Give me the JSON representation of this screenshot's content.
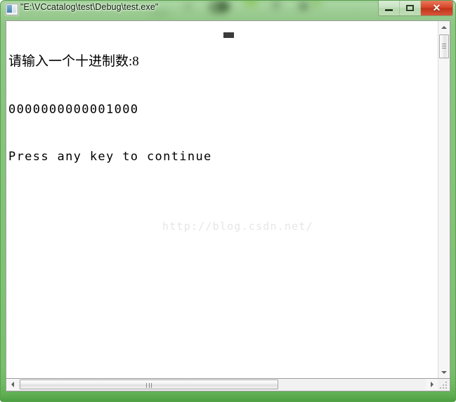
{
  "window": {
    "title": "\"E:\\VCcatalog\\test\\Debug\\test.exe\"",
    "icon": "console-window-icon",
    "frame_color": "#8ec685",
    "buttons": {
      "minimize_label": "",
      "maximize_label": "",
      "close_label": "✕",
      "close_color": "#c13418"
    }
  },
  "console": {
    "lines": [
      "请输入一个十进制数:8",
      "0000000000001000",
      "Press any key to continue"
    ],
    "cursor": "block-cursor",
    "background": "#ffffff",
    "text_color": "#000000"
  },
  "watermark": {
    "text": "http://blog.csdn.net/",
    "color": "#e6e6e6"
  },
  "scrollbars": {
    "vertical": {
      "up_arrow": "triangle-up-icon",
      "down_arrow": "triangle-down-icon",
      "thumb": "vertical-scroll-thumb"
    },
    "horizontal": {
      "left_arrow": "triangle-left-icon",
      "right_arrow": "triangle-right-icon",
      "thumb": "horizontal-scroll-thumb"
    },
    "resize_grip": "resize-grip-icon"
  }
}
